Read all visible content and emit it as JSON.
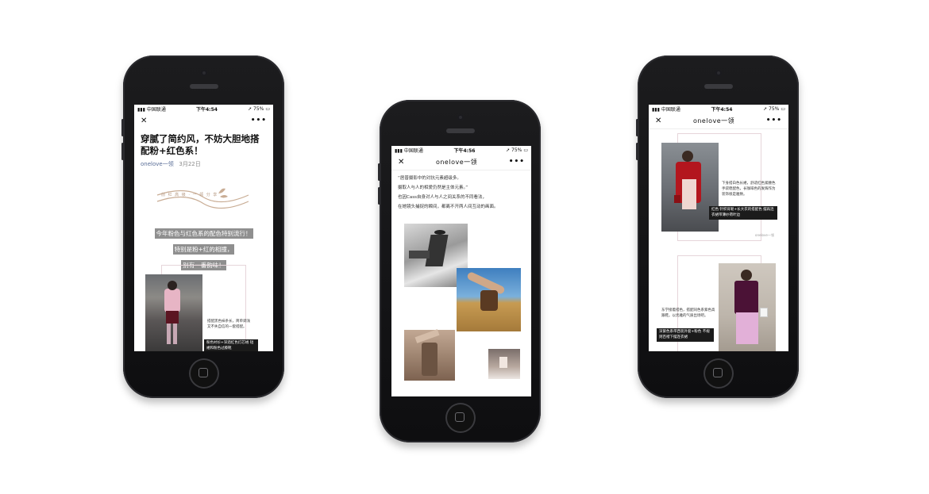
{
  "phones": [
    {
      "status": {
        "carrier": "中国联通",
        "time": "下午4:54",
        "battery": "75%"
      },
      "nav": {
        "close": "✕",
        "title": "",
        "more": "•••"
      },
      "article": {
        "title": "穿腻了简约风，不妨大胆地搭配粉+红色系！",
        "author": "onelove一领",
        "date": "3月22日",
        "logo_text": "前 红 高 级 · 一 领 分 享",
        "highlights": [
          "今年粉色与红色系的配色特别流行！",
          "特别是粉+红的相撞，",
          "别有一番韵味！"
        ],
        "small_caption": "搭配黑色袜条长，简单调浅 又不失自信的一套搭配。",
        "dark_caption": "粉色衬衫+深酒红色灯芯绒 短裙和粉色过膝靴"
      }
    },
    {
      "status": {
        "carrier": "中国联通",
        "time": "下午4:56",
        "battery": "75%"
      },
      "nav": {
        "close": "✕",
        "title": "onelove一领",
        "more": "•••"
      },
      "paragraphs": [
        "“居普摄影中的对抗元素超级多。",
        "摄取人与人的相爱仍然是主体元素。”",
        "也因Cass自身对人与人之间关系的不同看法，",
        "在她镜头捕捉的瞬间，都离不开两人间互动的画面。"
      ]
    },
    {
      "status": {
        "carrier": "中国联通",
        "time": "下午4:54",
        "battery": "75%"
      },
      "nav": {
        "close": "✕",
        "title": "onelove一领",
        "more": "•••"
      },
      "blocks": [
        {
          "small_caption": "下身搭白色长裙，舒适红色紧腰色手袋稳配色，长咖啡色的发辉作为装饰很是雅致。",
          "dark_caption": "红色 针织背呢+长大衣的搭配色 摆再连衣裙带薄纱荷叶边"
        },
        {
          "small_caption": "东学接着搭色，搭配同色系紫色高跟鞋。以优雅的气质出场吧。",
          "dark_caption": "深紫色系带西装外套+粉色 不规则百褶下摆连衣裙"
        }
      ],
      "watermark": "onelove一领"
    }
  ],
  "colors": {
    "phone_body": "#111113",
    "highlight_bg": "#8f8f8f",
    "caption_bg": "#1b1b1b"
  }
}
